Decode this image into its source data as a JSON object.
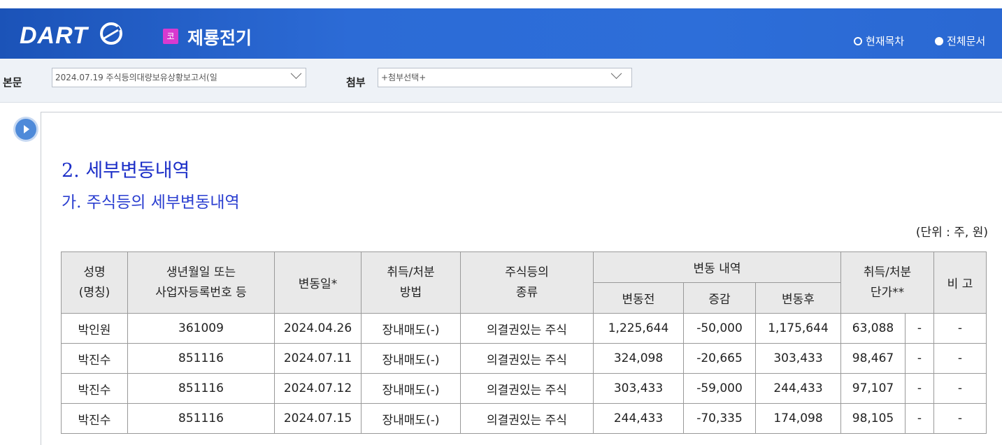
{
  "header": {
    "logo_text": "DART",
    "doc_badge": "코",
    "doc_title": "제룡전기",
    "view_options": [
      {
        "label": "현재목차",
        "selected": false
      },
      {
        "label": "전체문서",
        "selected": true
      }
    ],
    "colors": {
      "header_bg": "#2c6bd6",
      "badge": "#d83ad0",
      "heading": "#1c2fc8"
    }
  },
  "toolbar": {
    "main_label": "본문",
    "main_select": "2024.07.19  주식등의대량보유상황보고서(일",
    "attach_label": "첨부",
    "attach_select": "+첨부선택+"
  },
  "content": {
    "heading": "2. 세부변동내역",
    "subheading": "가. 주식등의 세부변동내역",
    "unit_note": "(단위 : 주, 원)",
    "table": {
      "headers": {
        "name": "성명\n(명칭)",
        "id": "생년월일 또는\n사업자등록번호 등",
        "date": "변동일*",
        "method": "취득/처분\n방법",
        "type": "주식등의\n종류",
        "change_group": "변동 내역",
        "before": "변동전",
        "delta": "증감",
        "after": "변동후",
        "price": "취득/처분\n단가**",
        "note": "비 고"
      },
      "rows": [
        {
          "name": "박인원",
          "id": "361009",
          "date": "2024.04.26",
          "method": "장내매도(-)",
          "type": "의결권있는 주식",
          "before": "1,225,644",
          "delta": "-50,000",
          "after": "1,175,644",
          "price": "63,088",
          "price_extra": "-",
          "note": "-"
        },
        {
          "name": "박진수",
          "id": "851116",
          "date": "2024.07.11",
          "method": "장내매도(-)",
          "type": "의결권있는 주식",
          "before": "324,098",
          "delta": "-20,665",
          "after": "303,433",
          "price": "98,467",
          "price_extra": "-",
          "note": "-"
        },
        {
          "name": "박진수",
          "id": "851116",
          "date": "2024.07.12",
          "method": "장내매도(-)",
          "type": "의결권있는 주식",
          "before": "303,433",
          "delta": "-59,000",
          "after": "244,433",
          "price": "97,107",
          "price_extra": "-",
          "note": "-"
        },
        {
          "name": "박진수",
          "id": "851116",
          "date": "2024.07.15",
          "method": "장내매도(-)",
          "type": "의결권있는 주식",
          "before": "244,433",
          "delta": "-70,335",
          "after": "174,098",
          "price": "98,105",
          "price_extra": "-",
          "note": "-"
        }
      ]
    }
  }
}
